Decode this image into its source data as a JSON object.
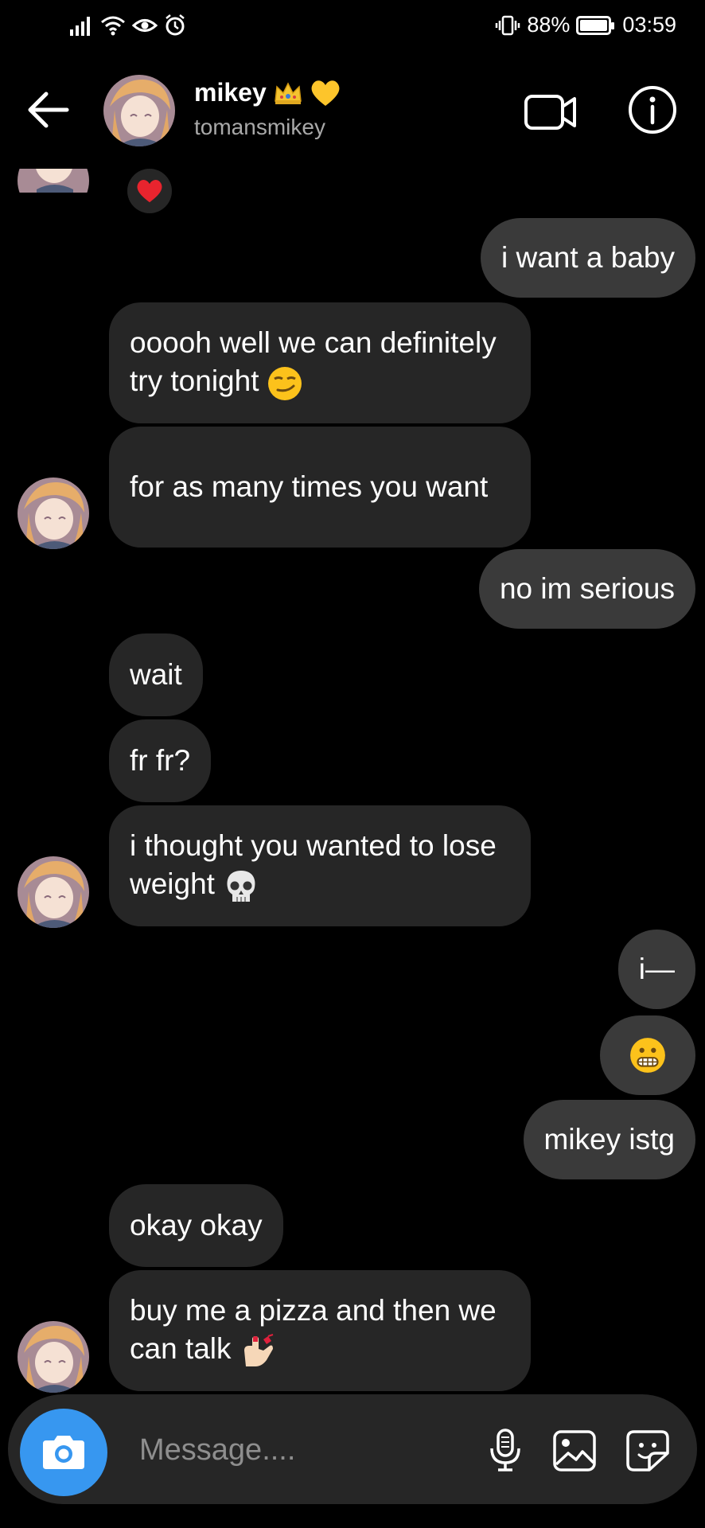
{
  "status_bar": {
    "battery_percent": "88%",
    "time": "03:59"
  },
  "header": {
    "name": "mikey",
    "username": "tomansmikey"
  },
  "messages": [
    {
      "side": "in",
      "text": "ooooh well we can definitely try tonight"
    },
    {
      "side": "in",
      "text": "for as many times you want"
    },
    {
      "side": "out",
      "text": "i want a baby"
    },
    {
      "side": "out",
      "text": "no im serious"
    },
    {
      "side": "in",
      "text": "wait"
    },
    {
      "side": "in",
      "text": "fr fr?"
    },
    {
      "side": "in",
      "text": "i thought you wanted to lose weight"
    },
    {
      "side": "out",
      "text": "i—"
    },
    {
      "side": "out",
      "text": "mikey istg"
    },
    {
      "side": "in",
      "text": "okay okay"
    },
    {
      "side": "in",
      "text": "buy me a pizza and then we can talk"
    }
  ],
  "composer": {
    "placeholder": "Message...."
  },
  "colors": {
    "background": "#000000",
    "incoming_bubble": "#262626",
    "outgoing_bubble": "#3a3a3a",
    "camera_button": "#3797f0",
    "secondary_text": "#a8a8a8"
  },
  "icons": [
    "back-arrow-icon",
    "video-call-icon",
    "info-icon",
    "camera-icon",
    "microphone-icon",
    "gallery-icon",
    "sticker-icon",
    "heart-reaction-icon"
  ]
}
